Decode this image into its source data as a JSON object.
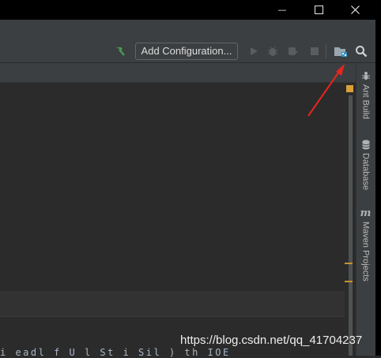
{
  "window": {
    "minimize_glyph": "—",
    "maximize_glyph": "☐",
    "close_glyph": "✕"
  },
  "toolbar": {
    "add_configuration_label": "Add Configuration...",
    "icons": [
      "build-hammer-icon",
      "run-icon",
      "debug-icon",
      "coverage-icon",
      "stop-icon",
      "project-structure-icon",
      "search-icon"
    ]
  },
  "tool_windows": {
    "items": [
      {
        "label": "Ant Build",
        "icon": "ant-icon"
      },
      {
        "label": "Database",
        "icon": "database-icon"
      },
      {
        "label": "Maven Projects",
        "icon": "maven-icon"
      }
    ]
  },
  "editor": {
    "partial_code": "i     eadl f  U l  St i   Sil      ) th      IOE"
  },
  "annotation": {
    "color": "#e8261e"
  },
  "watermark": {
    "text": "https://blog.csdn.net/qq_41704237"
  }
}
